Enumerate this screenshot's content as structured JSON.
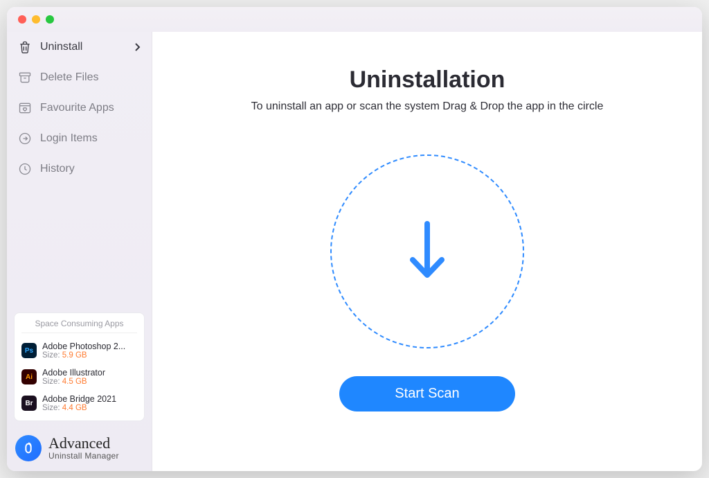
{
  "sidebar": {
    "items": [
      {
        "label": "Uninstall"
      },
      {
        "label": "Delete Files"
      },
      {
        "label": "Favourite Apps"
      },
      {
        "label": "Login Items"
      },
      {
        "label": "History"
      }
    ]
  },
  "space_card": {
    "title": "Space Consuming Apps",
    "apps": [
      {
        "name": "Adobe Photoshop 2...",
        "size_label": "Size:",
        "size": "5.9 GB",
        "badge": "Ps"
      },
      {
        "name": "Adobe Illustrator",
        "size_label": "Size:",
        "size": "4.5 GB",
        "badge": "Ai"
      },
      {
        "name": "Adobe Bridge 2021",
        "size_label": "Size:",
        "size": "4.4 GB",
        "badge": "Br"
      }
    ]
  },
  "brand": {
    "title": "Advanced",
    "subtitle": "Uninstall Manager"
  },
  "main": {
    "title": "Uninstallation",
    "subtitle": "To uninstall an app or scan the system Drag & Drop the app in the circle",
    "button": "Start Scan"
  }
}
